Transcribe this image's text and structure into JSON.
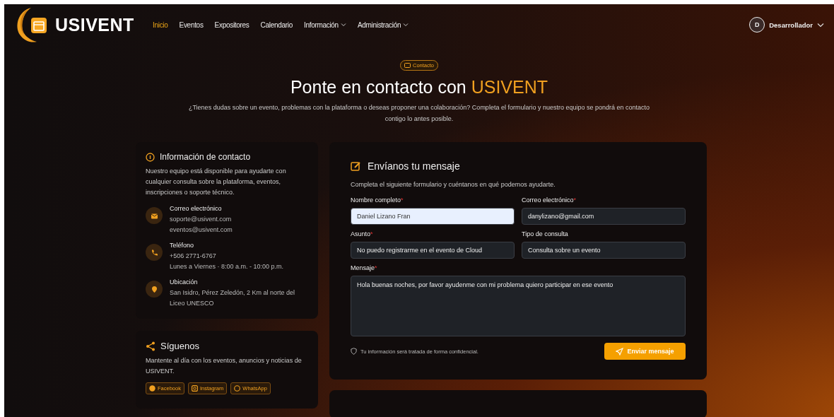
{
  "header": {
    "logo_text": "USIVENT",
    "nav": [
      {
        "label": "Inicio",
        "selected": true,
        "dropdown": false
      },
      {
        "label": "Eventos",
        "selected": false,
        "dropdown": false
      },
      {
        "label": "Expositores",
        "selected": false,
        "dropdown": false
      },
      {
        "label": "Calendario",
        "selected": false,
        "dropdown": false
      },
      {
        "label": "Información",
        "selected": false,
        "dropdown": true
      },
      {
        "label": "Administración",
        "selected": false,
        "dropdown": true
      }
    ],
    "user": {
      "initial": "D",
      "name": "Desarrollador"
    }
  },
  "hero": {
    "badge": "Contacto",
    "title": "Ponte en contacto con",
    "title_highlight": "USIVENT",
    "subtitle": "¿Tienes dudas sobre un evento, problemas con la plataforma o deseas proponer una colaboración? Completa el formulario y nuestro equipo se pondrá en contacto contigo lo antes posible."
  },
  "contact_info": {
    "title": "Información de contacto",
    "description": "Nuestro equipo está disponible para ayudarte con cualquier consulta sobre la plataforma, eventos, inscripciones o soporte técnico.",
    "items": [
      {
        "kind": "email",
        "label": "Correo electrónico",
        "lines": [
          "soporte@usivent.com",
          "eventos@usivent.com"
        ]
      },
      {
        "kind": "phone",
        "label": "Teléfono",
        "lines": [
          "+506 2771-6767",
          "Lunes a Viernes · 8:00 a.m. - 10:00 p.m."
        ]
      },
      {
        "kind": "location",
        "label": "Ubicación",
        "lines": [
          "San Isidro, Pérez Zeledón, 2 Km al norte del Liceo UNESCO"
        ]
      }
    ]
  },
  "social": {
    "title": "Síguenos",
    "description": "Mantente al día con los eventos, anuncios y noticias de USIVENT.",
    "links": [
      {
        "kind": "facebook",
        "label": "Facebook"
      },
      {
        "kind": "instagram",
        "label": "Instagram"
      },
      {
        "kind": "whatsapp",
        "label": "WhatsApp"
      }
    ]
  },
  "form": {
    "title": "Envíanos tu mensaje",
    "description": "Completa el siguiente formulario y cuéntanos en qué podemos ayudarte.",
    "fields": [
      {
        "kind": "input",
        "label": "Nombre completo",
        "mark": "*",
        "value": "Daniel Lizano Fran",
        "focused": true
      },
      {
        "kind": "input",
        "label": "Correo electrónico",
        "mark": "*",
        "value": "danylizano@gmail.com",
        "focused": false
      },
      {
        "kind": "input",
        "label": "Asunto",
        "mark": "*",
        "value": "No puedo registrarme en el evento de Cloud",
        "focused": false
      },
      {
        "kind": "input",
        "label": "Tipo de consulta",
        "value": "Consulta sobre un evento",
        "focused": false
      },
      {
        "kind": "textarea",
        "label": "Mensaje",
        "mark": "*",
        "value": "Hola buenas noches, por favor ayudenme con mi problema quiero participar en ese evento",
        "focused": false
      }
    ],
    "privacy_note": "Tu información será tratada de forma confidencial.",
    "submit": "Enviar mensaje"
  }
}
